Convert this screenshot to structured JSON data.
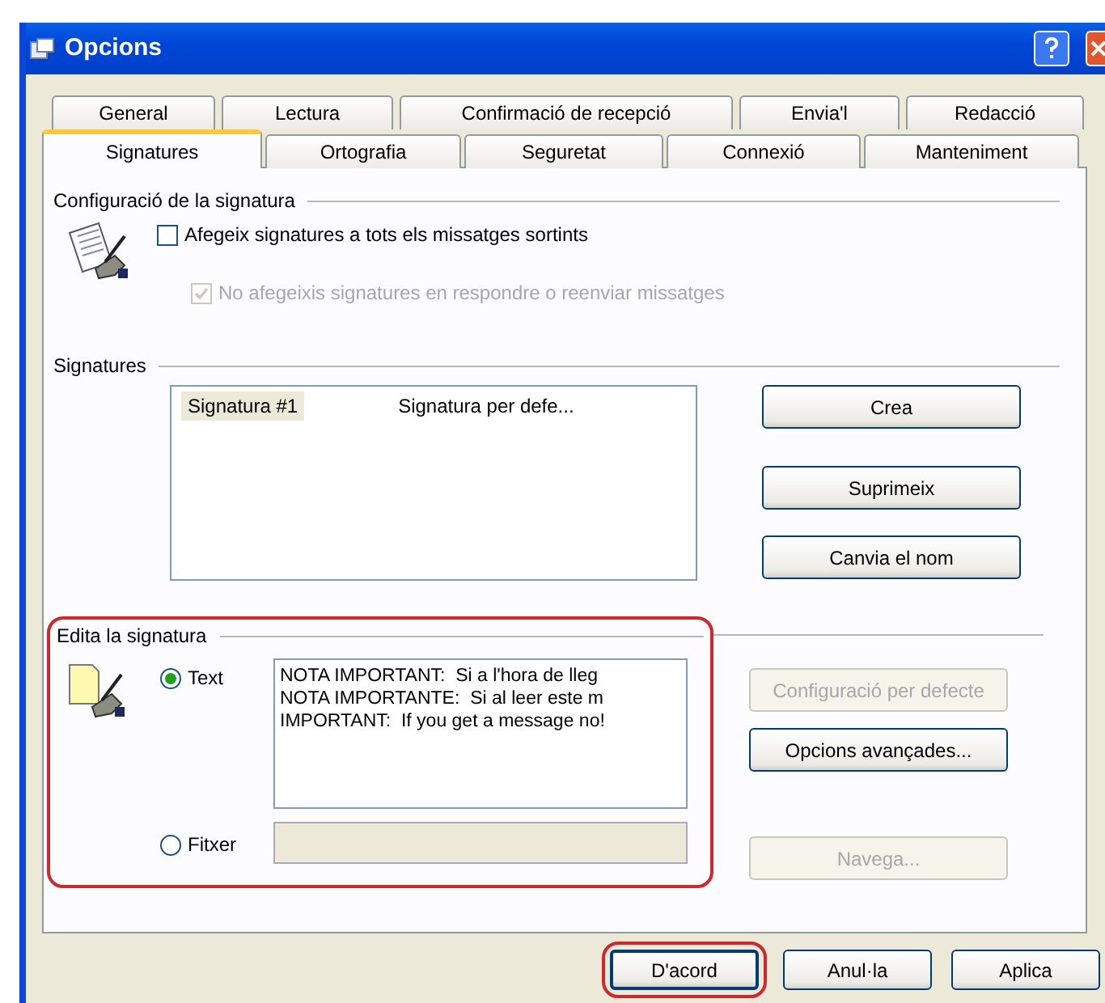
{
  "window": {
    "title": "Opcions"
  },
  "tab_rows": [
    [
      {
        "label": "General",
        "selected": false
      },
      {
        "label": "Lectura",
        "selected": false
      },
      {
        "label": "Confirmació de recepció",
        "selected": false
      },
      {
        "label": "Envia'l",
        "selected": false
      },
      {
        "label": "Redacció",
        "selected": false
      }
    ],
    [
      {
        "label": "Signatures",
        "selected": true
      },
      {
        "label": "Ortografia",
        "selected": false
      },
      {
        "label": "Seguretat",
        "selected": false
      },
      {
        "label": "Connexió",
        "selected": false
      },
      {
        "label": "Manteniment",
        "selected": false
      }
    ]
  ],
  "settings_group": {
    "title": "Configuració de la signatura",
    "options": [
      {
        "label": "Afegeix signatures a tots els missatges sortints",
        "checked": false,
        "disabled": false
      },
      {
        "label": "No afegeixis signatures en respondre o reenviar missatges",
        "checked": true,
        "disabled": true
      }
    ]
  },
  "signatures_group": {
    "title": "Signatures",
    "rows": [
      {
        "name": "Signatura #1",
        "description": "Signatura per defe...",
        "selected": true
      }
    ],
    "buttons": [
      {
        "label": "Crea",
        "disabled": false
      },
      {
        "label": "Suprimeix",
        "disabled": false
      },
      {
        "label": "Canvia el nom",
        "disabled": false
      }
    ]
  },
  "edit_group": {
    "title": "Edita la signatura",
    "highlighted": true,
    "sources": [
      {
        "label": "Text",
        "selected": true,
        "lines": [
          "NOTA IMPORTANT:  Si a l'hora de lleg",
          "NOTA IMPORTANTE:  Si al leer este m",
          "IMPORTANT:  If you get a message no!"
        ]
      },
      {
        "label": "Fitxer",
        "selected": false
      }
    ],
    "buttons": [
      {
        "label": "Configuració per defecte",
        "disabled": true
      },
      {
        "label": "Opcions avançades...",
        "disabled": false
      },
      {
        "label": "Navega...",
        "disabled": true
      }
    ]
  },
  "footer_buttons": [
    {
      "label": "D'acord",
      "highlighted": true
    },
    {
      "label": "Anul·la",
      "highlighted": false
    },
    {
      "label": "Aplica",
      "highlighted": false
    }
  ]
}
